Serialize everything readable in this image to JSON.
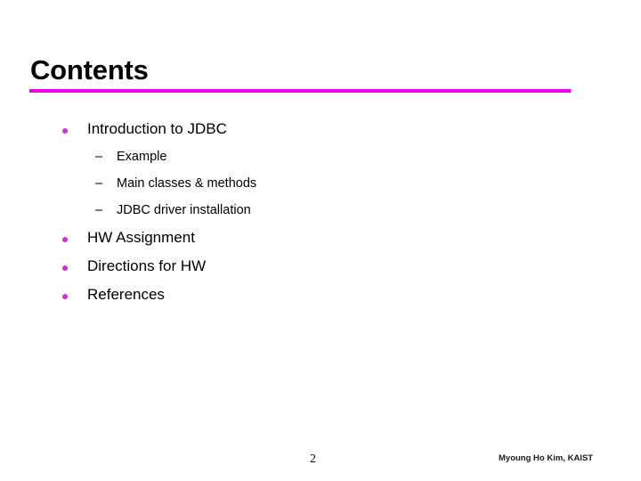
{
  "slide": {
    "title": "Contents",
    "background_color": "#ffffff",
    "rule_color": "#ee00ee",
    "bullet_color": "#cc33cc",
    "text_color": "#000000"
  },
  "body": {
    "items": [
      {
        "level": 1,
        "marker": "dot",
        "text": "Introduction to JDBC"
      },
      {
        "level": 2,
        "marker": "–",
        "text": "Example"
      },
      {
        "level": 2,
        "marker": "–",
        "text": "Main classes & methods"
      },
      {
        "level": 2,
        "marker": "–",
        "text": "JDBC driver installation"
      },
      {
        "level": 1,
        "marker": "dot",
        "text": "HW Assignment"
      },
      {
        "level": 1,
        "marker": "dot",
        "text": "Directions for HW"
      },
      {
        "level": 1,
        "marker": "dot",
        "text": "References"
      }
    ]
  },
  "footer": {
    "page_number": "2",
    "credit": "Myoung Ho Kim, KAIST"
  }
}
